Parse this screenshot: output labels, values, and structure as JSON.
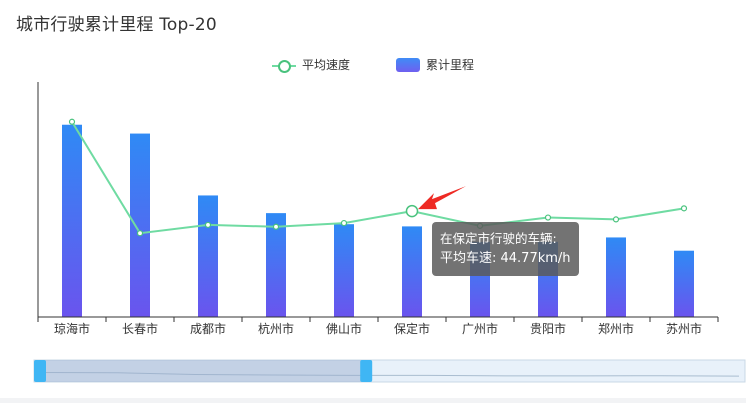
{
  "header": {
    "title": "城市行驶累计里程 Top-20"
  },
  "legend": {
    "line_label": "平均速度",
    "bar_label": "累计里程"
  },
  "tooltip": {
    "line1": "在保定市行驶的车辆:",
    "line2": "平均车速: 44.77km/h"
  },
  "colors": {
    "line": "#6fdba2",
    "line_point": "#49c27d",
    "bar_top": "#2f8af5",
    "bar_bottom": "#6a54ee",
    "arrow": "#ee2a24",
    "zoom_handle": "#3fb6f4"
  },
  "chart_data": {
    "type": "bar",
    "categories": [
      "琼海市",
      "长春市",
      "成都市",
      "杭州市",
      "佛山市",
      "保定市",
      "广州市",
      "贵阳市",
      "郑州市",
      "苏州市"
    ],
    "series": [
      {
        "name": "累计里程",
        "type": "bar",
        "values": [
          87,
          83,
          55,
          47,
          42,
          41,
          34,
          34,
          36,
          30
        ]
      },
      {
        "name": "平均速度",
        "type": "line",
        "values": [
          106,
          45.5,
          50,
          49,
          51,
          57.5,
          49.5,
          54,
          53,
          59
        ]
      }
    ],
    "ylim_bar": [
      0,
      100
    ],
    "ylim_line": [
      0,
      120
    ],
    "grid": false,
    "legend_position": "top-center",
    "highlight_category": "保定市"
  }
}
